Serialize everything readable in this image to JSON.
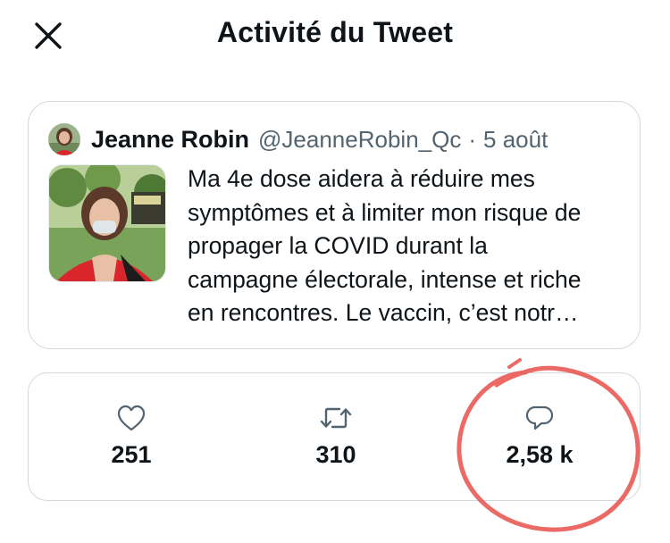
{
  "header": {
    "title": "Activité du Tweet"
  },
  "tweet": {
    "author_name": "Jeanne Robin",
    "author_handle": "@JeanneRobin_Qc",
    "separator": "·",
    "date": "5 août",
    "text_lines": [
      "Ma 4e dose aidera à réduire mes",
      "symptômes et à limiter mon risque de",
      "propager la COVID durant la",
      "campagne électorale, intense et riche",
      "en rencontres. Le vaccin, c’est notr…"
    ]
  },
  "stats": {
    "likes": "251",
    "retweets": "310",
    "replies": "2,58 k"
  },
  "icons": {
    "close": "close-icon",
    "like": "heart-icon",
    "retweet": "retweet-icon",
    "reply": "speech-bubble-icon"
  },
  "colors": {
    "text": "#0f1419",
    "secondary_text": "#536471",
    "border": "#cfd9de",
    "annotation": "#e8504a"
  }
}
